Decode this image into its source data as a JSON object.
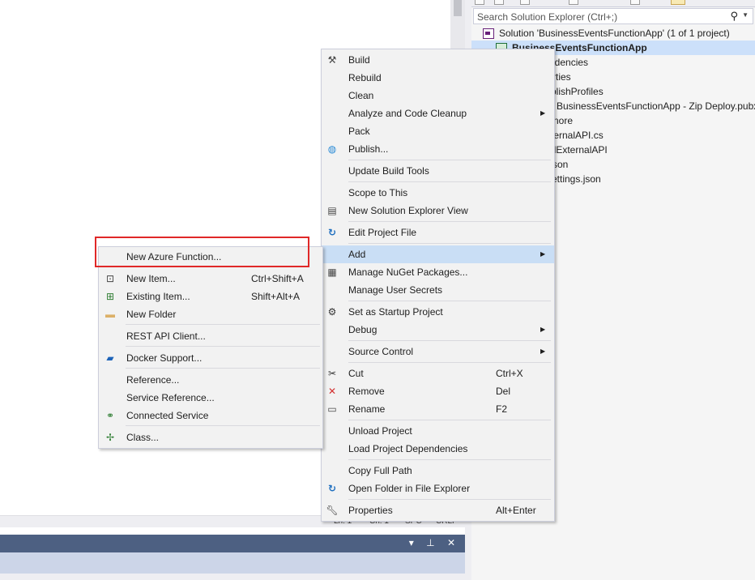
{
  "status_bar": {
    "ln": "Ln: 1",
    "ch": "Ch: 1",
    "enc": "SPC",
    "eol": "CRLF"
  },
  "panel": {
    "buttons": "▾ ⊥ ✕"
  },
  "solution_explorer": {
    "search_placeholder": "Search Solution Explorer (Ctrl+;)",
    "tree": [
      {
        "label": "Solution 'BusinessEventsFunctionApp' (1 of 1 project)",
        "icon": "solution-icon"
      },
      {
        "label": "BusinessEventsFunctionApp",
        "icon": "csharp-project-icon",
        "selected": true
      },
      {
        "label": "ndencies"
      },
      {
        "label": "rties"
      },
      {
        "label": "blishProfiles"
      },
      {
        "label": "BusinessEventsFunctionApp - Zip Deploy.pubxml"
      },
      {
        "label": "nore"
      },
      {
        "label": "ternalAPI.cs"
      },
      {
        "label": "llExternalAPI"
      },
      {
        "label": "son"
      },
      {
        "label": "ettings.json"
      }
    ]
  },
  "context_menu": {
    "items": [
      {
        "label": "Build",
        "icon": "build-icon"
      },
      {
        "label": "Rebuild"
      },
      {
        "label": "Clean"
      },
      {
        "label": "Analyze and Code Cleanup",
        "submenu": true
      },
      {
        "label": "Pack"
      },
      {
        "label": "Publish...",
        "icon": "globe-icon"
      },
      {
        "label": "Update Build Tools"
      },
      {
        "label": "Scope to This"
      },
      {
        "label": "New Solution Explorer View",
        "icon": "window-icon"
      },
      {
        "label": "Edit Project File",
        "icon": "refresh-arrow-icon"
      },
      {
        "label": "Add",
        "submenu": true,
        "highlighted": true
      },
      {
        "label": "Manage NuGet Packages...",
        "icon": "nuget-icon"
      },
      {
        "label": "Manage User Secrets"
      },
      {
        "label": "Set as Startup Project",
        "icon": "gear-icon"
      },
      {
        "label": "Debug",
        "submenu": true
      },
      {
        "label": "Source Control",
        "submenu": true
      },
      {
        "label": "Cut",
        "shortcut": "Ctrl+X",
        "icon": "scissors-icon"
      },
      {
        "label": "Remove",
        "shortcut": "Del",
        "icon": "red-x-icon"
      },
      {
        "label": "Rename",
        "shortcut": "F2",
        "icon": "rename-icon"
      },
      {
        "label": "Unload Project"
      },
      {
        "label": "Load Project Dependencies"
      },
      {
        "label": "Copy Full Path"
      },
      {
        "label": "Open Folder in File Explorer",
        "icon": "refresh-arrow-icon"
      },
      {
        "label": "Properties",
        "shortcut": "Alt+Enter",
        "icon": "wrench-icon"
      }
    ]
  },
  "add_submenu": {
    "items": [
      {
        "label": "New Azure Function..."
      },
      {
        "label": "New Item...",
        "shortcut": "Ctrl+Shift+A",
        "icon": "new-item-icon"
      },
      {
        "label": "Existing Item...",
        "shortcut": "Shift+Alt+A",
        "icon": "existing-item-icon"
      },
      {
        "label": "New Folder",
        "icon": "folder-icon"
      },
      {
        "label": "REST API Client..."
      },
      {
        "label": "Docker Support...",
        "icon": "docker-icon"
      },
      {
        "label": "Reference..."
      },
      {
        "label": "Service Reference..."
      },
      {
        "label": "Connected Service",
        "icon": "connected-service-icon"
      },
      {
        "label": "Class...",
        "icon": "class-icon"
      }
    ]
  },
  "colors": {
    "menu_bg": "#f2f2f2",
    "highlight": "#c9def5",
    "callout": "#e02828",
    "panel_header": "#4d6082",
    "panel_body": "#ccd5e8"
  }
}
